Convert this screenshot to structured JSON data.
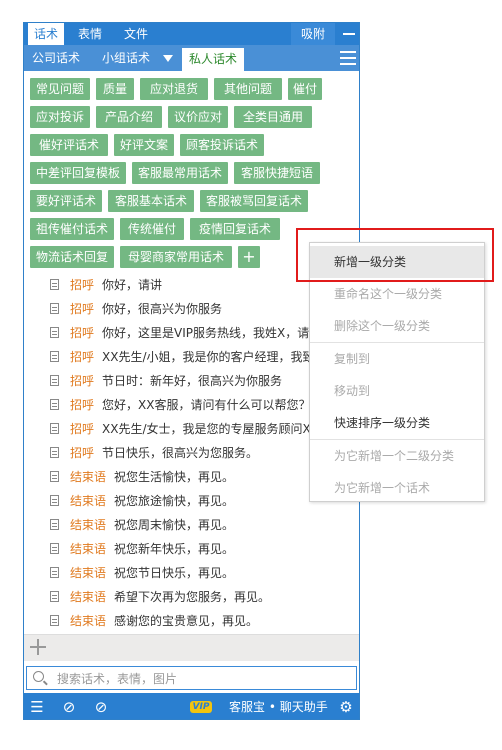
{
  "top_tabs": [
    {
      "label": "话术",
      "active": true
    },
    {
      "label": "表情",
      "active": false
    },
    {
      "label": "文件",
      "active": false
    }
  ],
  "pin_label": "吸附",
  "sub_tabs": [
    {
      "label": "公司话术",
      "active": false
    },
    {
      "label": "小组话术",
      "active": false
    },
    {
      "label": "私人话术",
      "active": true
    }
  ],
  "tags": [
    "常见问题",
    "质量",
    "应对退货",
    "其他问题",
    "催付",
    "应对投诉",
    "产品介绍",
    "议价应对",
    "全类目通用",
    "催好评话术",
    "好评文案",
    "顾客投诉话术",
    "中差评回复模板",
    "客服最常用话术",
    "客服快捷短语",
    "要好评话术",
    "客服基本话术",
    "客服被骂回复话术",
    "祖传催付话术",
    "传统催付",
    "疫情回复话术",
    "物流话术回复",
    "母婴商家常用话术"
  ],
  "add_tag_symbol": "+",
  "phrases": [
    {
      "category": "招呼",
      "text": "你好，请讲"
    },
    {
      "category": "招呼",
      "text": "你好，很高兴为你服务"
    },
    {
      "category": "招呼",
      "text": "你好，这里是VIP服务热线，我姓X，请"
    },
    {
      "category": "招呼",
      "text": "XX先生/小姐，我是你的客户经理，我致"
    },
    {
      "category": "招呼",
      "text": "节日时：新年好，很高兴为你服务"
    },
    {
      "category": "招呼",
      "text": "您好，XX客服，请问有什么可以帮您？"
    },
    {
      "category": "招呼",
      "text": "XX先生/女士，我是您的专屋服务顾问X"
    },
    {
      "category": "招呼",
      "text": "节日快乐，很高兴为您服务。"
    },
    {
      "category": "结束语",
      "text": "祝您生活愉快，再见。"
    },
    {
      "category": "结束语",
      "text": "祝您旅途愉快，再见。"
    },
    {
      "category": "结束语",
      "text": "祝您周末愉快，再见。"
    },
    {
      "category": "结束语",
      "text": "祝您新年快乐，再见。"
    },
    {
      "category": "结束语",
      "text": "祝您节日快乐，再见。"
    },
    {
      "category": "结束语",
      "text": "希望下次再为您服务，再见。"
    },
    {
      "category": "结束语",
      "text": "感谢您的宝贵意见，再见。"
    }
  ],
  "search": {
    "placeholder": "搜索话术，表情，图片"
  },
  "bottom": {
    "vip": "VIP",
    "brand": "客服宝 • 聊天助手"
  },
  "context_menu": [
    {
      "label": "新增一级分类",
      "enabled": true,
      "highlighted": true
    },
    {
      "label": "重命名这个一级分类",
      "enabled": false
    },
    {
      "label": "删除这个一级分类",
      "enabled": false
    },
    {
      "label": "复制到",
      "enabled": false
    },
    {
      "label": "移动到",
      "enabled": false
    },
    {
      "label": "快速排序一级分类",
      "enabled": true
    },
    {
      "label": "为它新增一个二级分类",
      "enabled": false
    },
    {
      "label": "为它新增一个话术",
      "enabled": false
    }
  ],
  "colors": {
    "accent": "#2a7fd0",
    "tag": "#74b883",
    "category": "#e07a1f",
    "highlight_border": "#e11b1b"
  }
}
